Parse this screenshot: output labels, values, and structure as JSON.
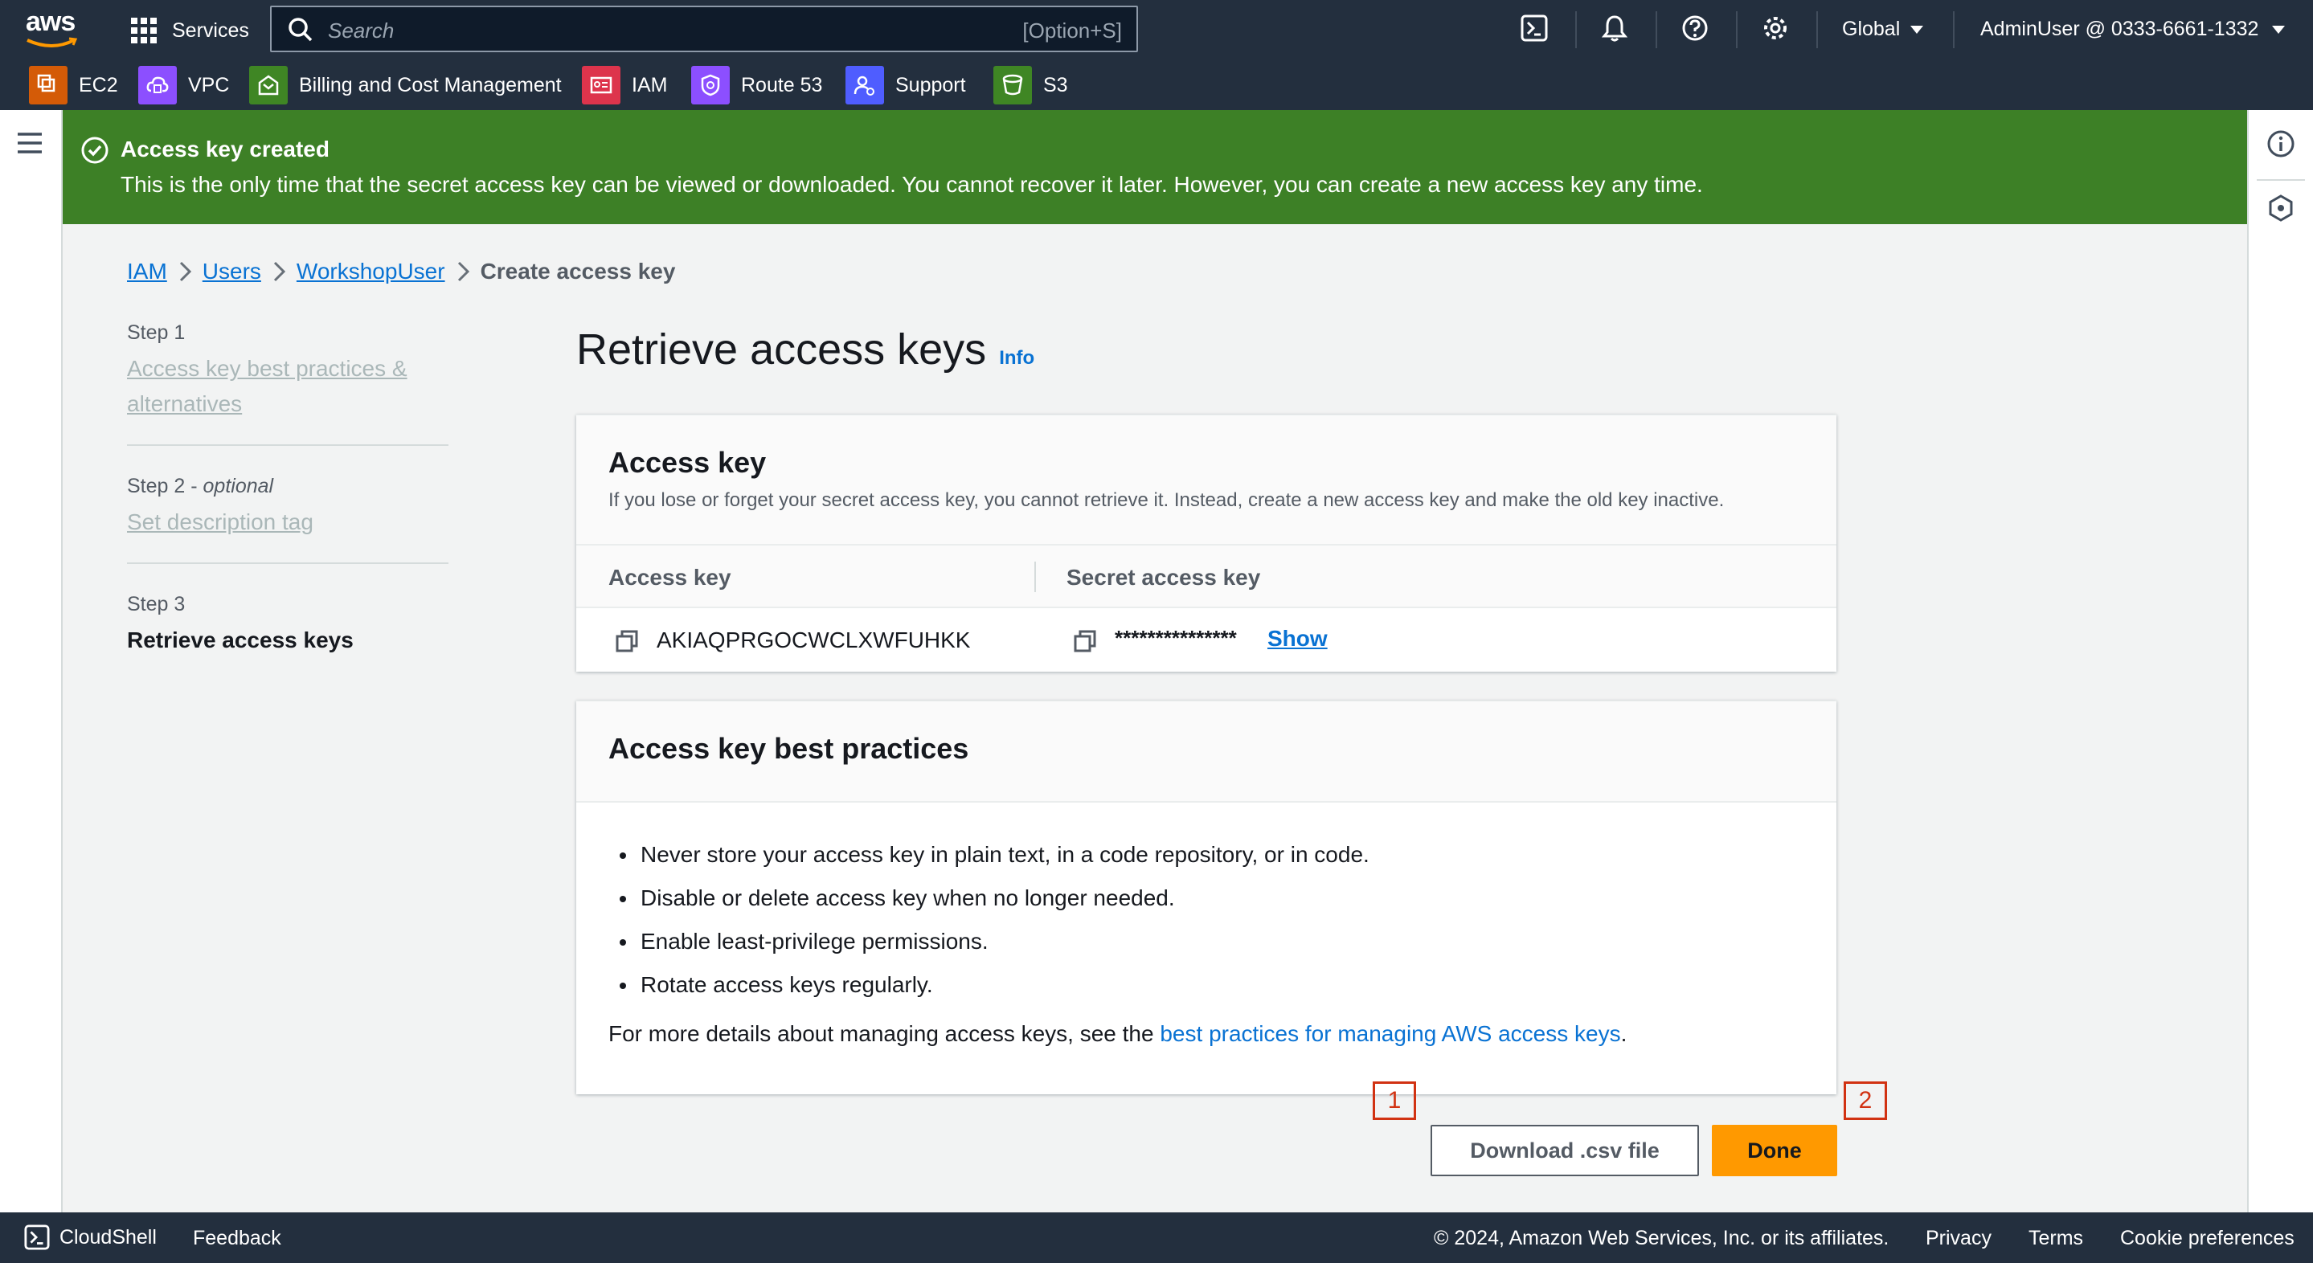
{
  "topnav": {
    "logo": "aws",
    "services_label": "Services",
    "search_placeholder": "Search",
    "search_shortcut": "[Option+S]",
    "region_label": "Global",
    "account_label": "AdminUser @ 0333-6661-1332",
    "icons": [
      "cloudshell-icon",
      "bell-icon",
      "help-icon",
      "settings-icon"
    ]
  },
  "shortcuts": [
    {
      "label": "EC2",
      "color": "#d45b07",
      "icon": "ec2-icon"
    },
    {
      "label": "VPC",
      "color": "#8c4fff",
      "icon": "vpc-icon"
    },
    {
      "label": "Billing and Cost Management",
      "color": "#3f8624",
      "icon": "billing-icon"
    },
    {
      "label": "IAM",
      "color": "#dd344c",
      "icon": "iam-icon"
    },
    {
      "label": "Route 53",
      "color": "#8c4fff",
      "icon": "route53-icon"
    },
    {
      "label": "Support",
      "color": "#4f5dff",
      "icon": "support-icon"
    },
    {
      "label": "S3",
      "color": "#3f8624",
      "icon": "s3-icon"
    }
  ],
  "flash": {
    "title": "Access key created",
    "message": "This is the only time that the secret access key can be viewed or downloaded. You cannot recover it later. However, you can create a new access key any time.",
    "color": "#3d8026"
  },
  "breadcrumb": {
    "items": [
      "IAM",
      "Users",
      "WorkshopUser"
    ],
    "current": "Create access key"
  },
  "steps": [
    {
      "step": "Step 1",
      "optional": "",
      "label": "Access key best practices &",
      "label2": "alternatives"
    },
    {
      "step": "Step 2 -",
      "optional": "optional",
      "label": "Set description tag",
      "label2": ""
    },
    {
      "step": "Step 3",
      "optional": "",
      "label": "Retrieve access keys",
      "label2": ""
    }
  ],
  "page": {
    "title": "Retrieve access keys",
    "info_link": "Info"
  },
  "access_key_card": {
    "title": "Access key",
    "description": "If you lose or forget your secret access key, you cannot retrieve it. Instead, create a new access key and make the old key inactive.",
    "col_access_key": "Access key",
    "col_secret": "Secret access key",
    "access_key_value": "AKIAQPRGOCWCLXWFUHKK",
    "secret_value": "***************",
    "show_label": "Show"
  },
  "best_practices_card": {
    "title": "Access key best practices",
    "items": [
      "Never store your access key in plain text, in a code repository, or in code.",
      "Disable or delete access key when no longer needed.",
      "Enable least-privilege permissions.",
      "Rotate access keys regularly."
    ],
    "more_prefix": "For more details about managing access keys, see the ",
    "more_link": "best practices for managing AWS access keys",
    "more_suffix": "."
  },
  "actions": {
    "download_label": "Download .csv file",
    "done_label": "Done",
    "marker_1": "1",
    "marker_2": "2",
    "accent": "#ff9900"
  },
  "footer": {
    "cloudshell": "CloudShell",
    "feedback": "Feedback",
    "copyright": "© 2024, Amazon Web Services, Inc. or its affiliates.",
    "privacy": "Privacy",
    "terms": "Terms",
    "cookie": "Cookie preferences"
  }
}
